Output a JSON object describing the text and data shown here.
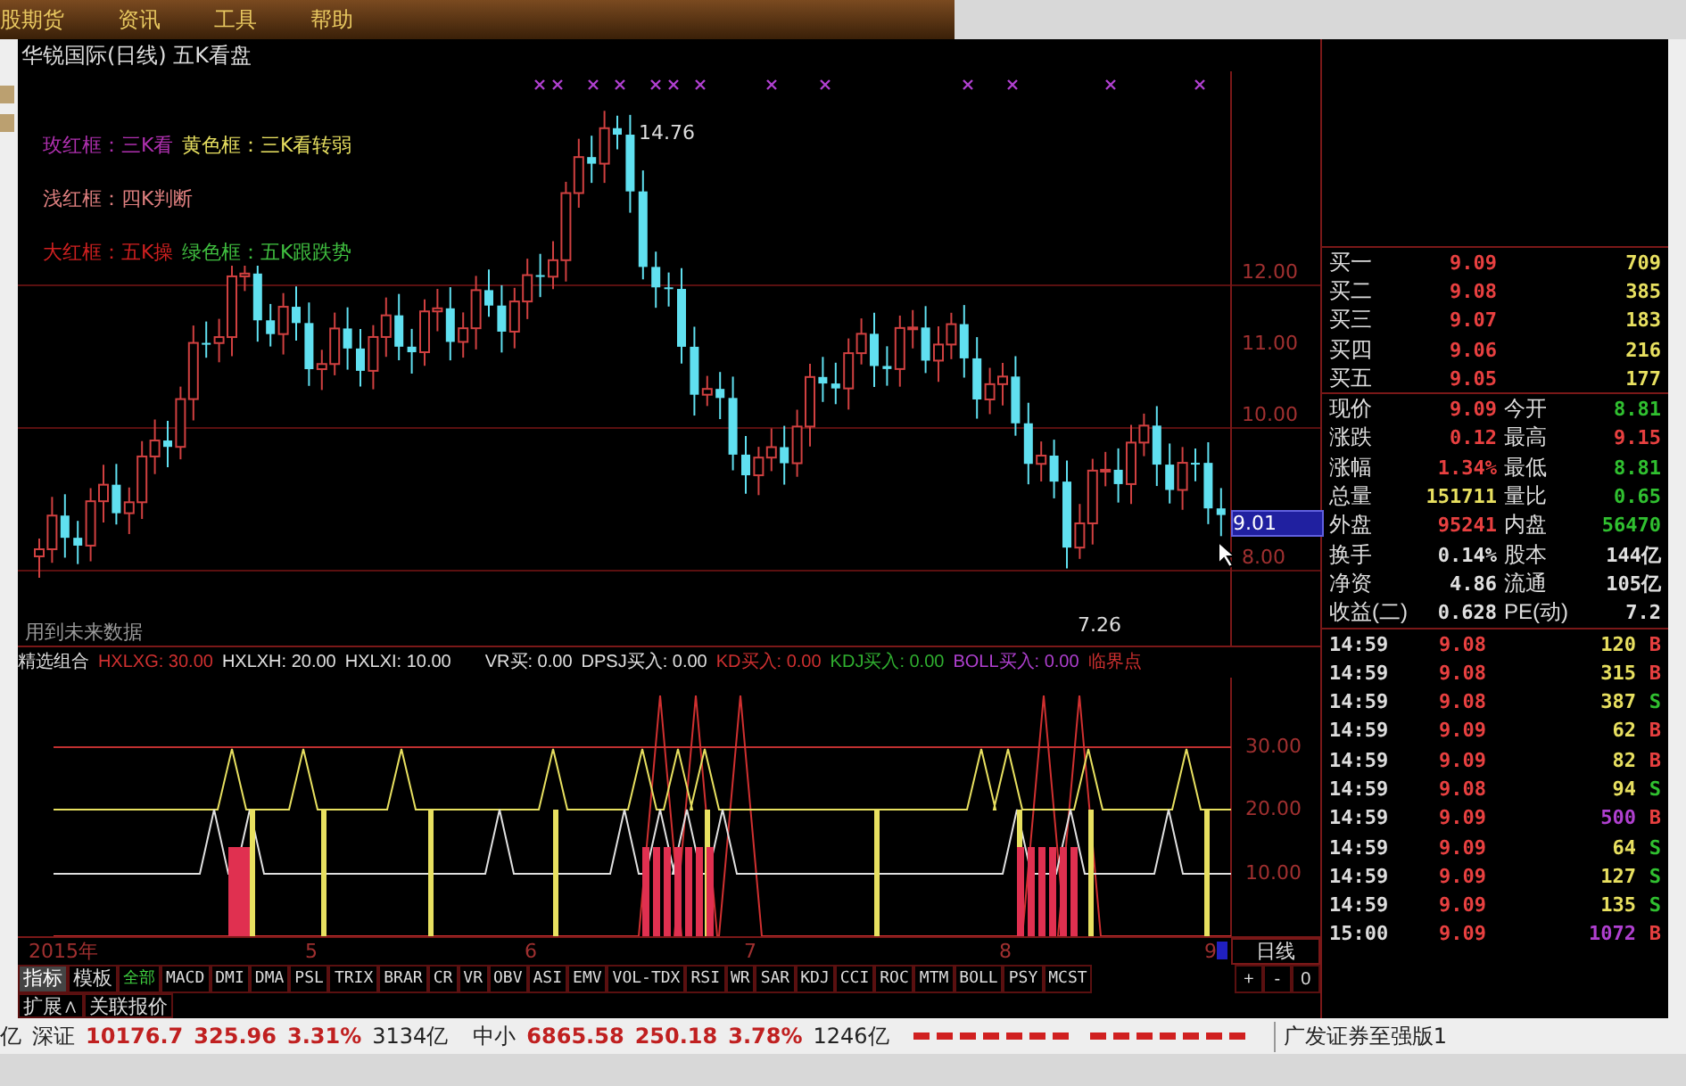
{
  "menu": [
    {
      "label": "股期货"
    },
    {
      "label": "资讯"
    },
    {
      "label": "工具"
    },
    {
      "label": "帮助"
    }
  ],
  "chart": {
    "title": "华锐国际(日线) 五K看盘",
    "legend": [
      {
        "text": "玫红框：三K看",
        "color": "#b030b0"
      },
      {
        "text": "黄色框：三K看转弱",
        "color": "#e8e060"
      },
      {
        "text": "浅红框：四K判断",
        "color": "#e08080"
      },
      {
        "text": "大红框：五K操",
        "color": "#d02020"
      },
      {
        "text": "绿色框：五K跟跌势",
        "color": "#40c040"
      }
    ],
    "price_ticks": [
      "12.00",
      "11.00",
      "10.00",
      "8.00"
    ],
    "high_label": "14.76",
    "low_label": "7.26",
    "cursor_price": "9.01",
    "note": "用到未来数据"
  },
  "indicator": {
    "name": "精选组合",
    "ticks": [
      "30.00",
      "20.00",
      "10.00"
    ],
    "values": [
      {
        "text": "HXLXG: 30.00",
        "color": "#d03030"
      },
      {
        "text": "HXLXH: 20.00",
        "color": "#e0e0e0"
      },
      {
        "text": "HXLXI: 10.00",
        "color": "#e0e0e0"
      },
      {
        "text": "VR买: 0.00",
        "color": "#e0e0e0"
      },
      {
        "text": "DPSJ买入: 0.00",
        "color": "#e0e0e0"
      },
      {
        "text": "KD买入: 0.00",
        "color": "#d03030"
      },
      {
        "text": "KDJ买入: 0.00",
        "color": "#30b030"
      },
      {
        "text": "BOLL买入: 0.00",
        "color": "#b040d0"
      },
      {
        "text": "临界点",
        "color": "#d03030"
      }
    ]
  },
  "x_axis": [
    "2015年",
    "5",
    "6",
    "7",
    "8",
    "9"
  ],
  "period_button": "日线",
  "zoom_buttons": [
    "+",
    "-",
    "0"
  ],
  "panel_tabs": [
    {
      "label": "指标",
      "selected": true
    },
    {
      "label": "模板",
      "selected": false
    }
  ],
  "filter_tabs": [
    {
      "label": "全部",
      "selected": true
    },
    {
      "label": "MACD",
      "selected": false
    },
    {
      "label": "DMI",
      "selected": false
    },
    {
      "label": "DMA",
      "selected": false
    },
    {
      "label": "PSL",
      "selected": false
    },
    {
      "label": "TRIX",
      "selected": false
    },
    {
      "label": "BRAR",
      "selected": false
    },
    {
      "label": "CR",
      "selected": false
    },
    {
      "label": "VR",
      "selected": false
    },
    {
      "label": "OBV",
      "selected": false
    },
    {
      "label": "ASI",
      "selected": false
    },
    {
      "label": "EMV",
      "selected": false
    },
    {
      "label": "VOL-TDX",
      "selected": false
    },
    {
      "label": "RSI",
      "selected": false
    },
    {
      "label": "WR",
      "selected": false
    },
    {
      "label": "SAR",
      "selected": false
    },
    {
      "label": "KDJ",
      "selected": false
    },
    {
      "label": "CCI",
      "selected": false
    },
    {
      "label": "ROC",
      "selected": false
    },
    {
      "label": "MTM",
      "selected": false
    },
    {
      "label": "BOLL",
      "selected": false
    },
    {
      "label": "PSY",
      "selected": false
    },
    {
      "label": "MCST",
      "selected": false
    }
  ],
  "sub_tabs": [
    "扩展∧",
    "关联报价"
  ],
  "order_book": [
    {
      "label": "买一",
      "price": "9.09",
      "volume": "709"
    },
    {
      "label": "买二",
      "price": "9.08",
      "volume": "385"
    },
    {
      "label": "买三",
      "price": "9.07",
      "volume": "183"
    },
    {
      "label": "买四",
      "price": "9.06",
      "volume": "216"
    },
    {
      "label": "买五",
      "price": "9.05",
      "volume": "177"
    }
  ],
  "quote": [
    {
      "pair": [
        {
          "label": "现价",
          "value": "9.09",
          "color": "#e84040"
        },
        {
          "label": "今开",
          "value": "8.81",
          "color": "#30c030"
        }
      ]
    },
    {
      "pair": [
        {
          "label": "涨跌",
          "value": "0.12",
          "color": "#e84040"
        },
        {
          "label": "最高",
          "value": "9.15",
          "color": "#e84040"
        }
      ]
    },
    {
      "pair": [
        {
          "label": "涨幅",
          "value": "1.34%",
          "color": "#e84040"
        },
        {
          "label": "最低",
          "value": "8.81",
          "color": "#30c030"
        }
      ]
    },
    {
      "pair": [
        {
          "label": "总量",
          "value": "151711",
          "color": "#e8e060"
        },
        {
          "label": "量比",
          "value": "0.65",
          "color": "#30c030"
        }
      ]
    },
    {
      "pair": [
        {
          "label": "外盘",
          "value": "95241",
          "color": "#e84040"
        },
        {
          "label": "内盘",
          "value": "56470",
          "color": "#30c030"
        }
      ]
    },
    {
      "pair": [
        {
          "label": "换手",
          "value": "0.14%",
          "color": "#e0e0e0"
        },
        {
          "label": "股本",
          "value": "144亿",
          "color": "#e0e0e0"
        }
      ]
    },
    {
      "pair": [
        {
          "label": "净资",
          "value": "4.86",
          "color": "#e0e0e0"
        },
        {
          "label": "流通",
          "value": "105亿",
          "color": "#e0e0e0"
        }
      ]
    },
    {
      "pair": [
        {
          "label": "收益(二)",
          "value": "0.628",
          "color": "#e0e0e0"
        },
        {
          "label": "PE(动)",
          "value": "7.2",
          "color": "#e0e0e0"
        }
      ]
    }
  ],
  "ticks": [
    {
      "time": "14:59",
      "price": "9.08",
      "volume": "120",
      "side": "B",
      "large": false
    },
    {
      "time": "14:59",
      "price": "9.08",
      "volume": "315",
      "side": "B",
      "large": false
    },
    {
      "time": "14:59",
      "price": "9.08",
      "volume": "387",
      "side": "S",
      "large": false
    },
    {
      "time": "14:59",
      "price": "9.09",
      "volume": "62",
      "side": "B",
      "large": false
    },
    {
      "time": "14:59",
      "price": "9.09",
      "volume": "82",
      "side": "B",
      "large": false
    },
    {
      "time": "14:59",
      "price": "9.08",
      "volume": "94",
      "side": "S",
      "large": false
    },
    {
      "time": "14:59",
      "price": "9.09",
      "volume": "500",
      "side": "B",
      "large": true
    },
    {
      "time": "14:59",
      "price": "9.09",
      "volume": "64",
      "side": "S",
      "large": false
    },
    {
      "time": "14:59",
      "price": "9.09",
      "volume": "127",
      "side": "S",
      "large": false
    },
    {
      "time": "14:59",
      "price": "9.09",
      "volume": "135",
      "side": "S",
      "large": false
    },
    {
      "time": "15:00",
      "price": "9.09",
      "volume": "1072",
      "side": "B",
      "large": true
    }
  ],
  "status_bar": {
    "lead": "亿",
    "indexes": [
      {
        "name": "深证",
        "value": "10176.7",
        "change": "325.96",
        "percent": "3.31%",
        "amount": "3134亿"
      },
      {
        "name": "中小",
        "value": "6865.58",
        "change": "250.18",
        "percent": "3.78%",
        "amount": "1246亿"
      }
    ],
    "broker": "广发证券至强版1"
  }
}
